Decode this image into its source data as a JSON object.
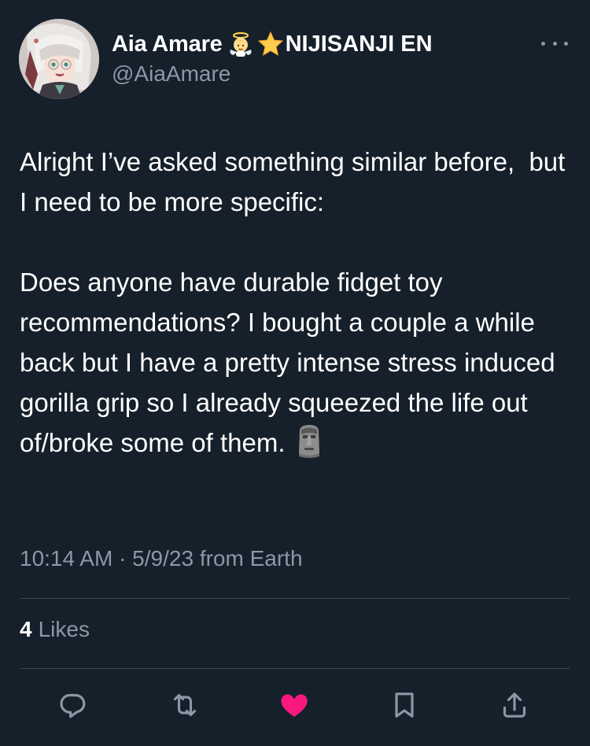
{
  "author": {
    "display_name": "Aia Amare",
    "name_suffix": "NIJISANJI EN",
    "handle": "@AiaAmare",
    "avatar_icon": "avatar-image",
    "name_emojis": [
      "baby-angel-emoji",
      "star-emoji"
    ]
  },
  "tweet": {
    "paragraph_1": "Alright I’ve asked something similar before,  but I need to be more specific:",
    "paragraph_2": "Does anyone have durable fidget toy recommendations? I bought a couple a while back but I have a pretty intense stress induced gorilla grip so I already squeezed the life out of/broke some of them.",
    "trailing_emoji": "moai-emoji"
  },
  "meta": {
    "timestamp": "10:14 AM · 5/9/23 from Earth"
  },
  "stats": {
    "likes_count": "4",
    "likes_label": "Likes"
  },
  "actions": [
    {
      "name": "reply",
      "icon": "reply-icon"
    },
    {
      "name": "retweet",
      "icon": "retweet-icon"
    },
    {
      "name": "like",
      "icon": "heart-icon",
      "active": true
    },
    {
      "name": "bookmark",
      "icon": "bookmark-icon"
    },
    {
      "name": "share",
      "icon": "share-icon"
    }
  ],
  "colors": {
    "background": "#15202b",
    "text_primary": "#ffffff",
    "text_secondary": "#8b98a5",
    "divider": "#38444d",
    "like_active": "#f91880"
  }
}
